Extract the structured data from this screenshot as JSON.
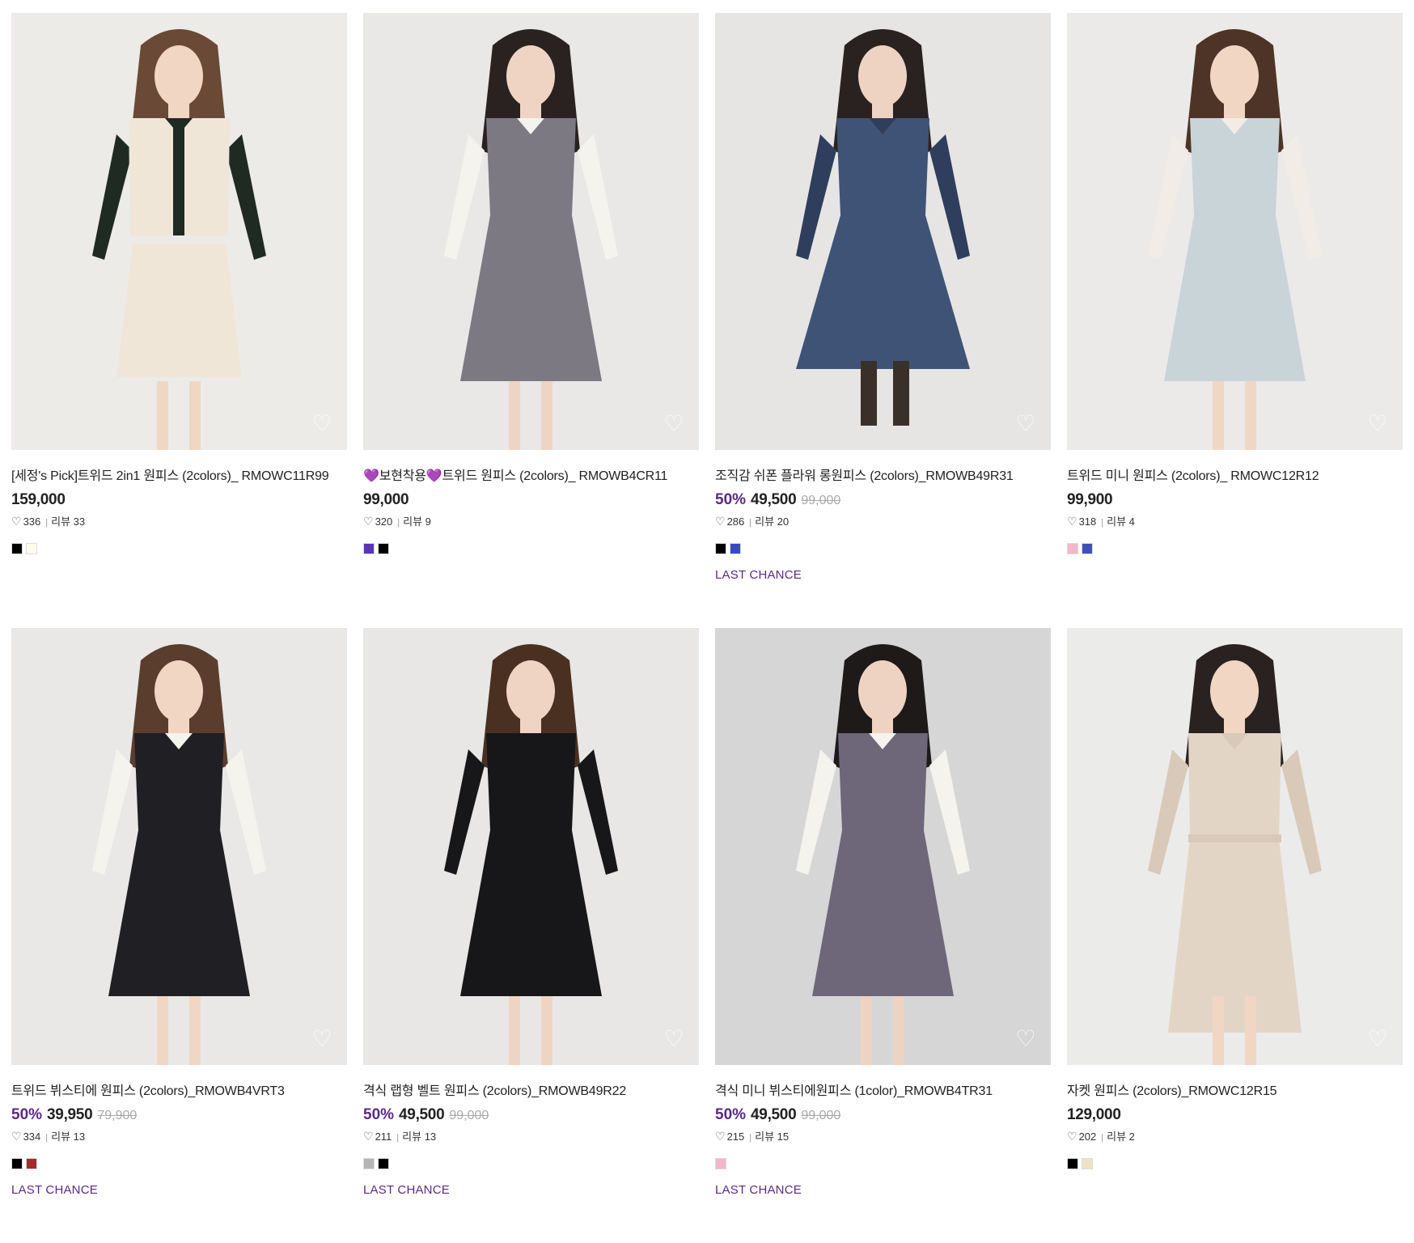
{
  "products": [
    {
      "name": "[세정's Pick]트위드 2in1 원피스 (2colors)_ RMOWC11R99",
      "discount": "",
      "price": "159,000",
      "original_price": "",
      "likes": "336",
      "reviews_label": "리뷰 33",
      "swatches": [
        "#000000",
        "#fffbea"
      ],
      "tag": "",
      "image": {
        "bg": "#ecebe8",
        "garment": "#efe6d8",
        "accent": "#1f2b22",
        "hair": "#6a4a36",
        "skin": "#f1d6c4",
        "type": "tweed-set"
      }
    },
    {
      "name": "💜보현착용💜트위드 원피스 (2colors)_ RMOWB4CR11",
      "discount": "",
      "price": "99,000",
      "original_price": "",
      "likes": "320",
      "reviews_label": "리뷰 9",
      "swatches": [
        "#5a35b5",
        "#000000"
      ],
      "tag": "",
      "image": {
        "bg": "#e9e8e6",
        "garment": "#7c7983",
        "accent": "#f5f3ee",
        "hair": "#2a2220",
        "skin": "#f0d4c3",
        "type": "vest-dress"
      }
    },
    {
      "name": "조직감 쉬폰 플라워 롱원피스 (2colors)_RMOWB49R31",
      "discount": "50%",
      "price": "49,500",
      "original_price": "99,000",
      "likes": "286",
      "reviews_label": "리뷰 20",
      "swatches": [
        "#000000",
        "#3549c4"
      ],
      "tag": "LAST CHANCE",
      "image": {
        "bg": "#e6e5e3",
        "garment": "#3f5377",
        "accent": "#2f3e5c",
        "hair": "#2a2220",
        "skin": "#efd3c2",
        "type": "long-dress"
      }
    },
    {
      "name": "트위드 미니 원피스 (2colors)_ RMOWC12R12",
      "discount": "",
      "price": "99,900",
      "original_price": "",
      "likes": "318",
      "reviews_label": "리뷰 4",
      "swatches": [
        "#f4b6c8",
        "#3f4fbf"
      ],
      "tag": "",
      "image": {
        "bg": "#ebeae8",
        "garment": "#c9d4d9",
        "accent": "#f1ede6",
        "hair": "#4e3426",
        "skin": "#f1d6c4",
        "type": "mini-dress"
      }
    },
    {
      "name": "트위드 뷔스티에 원피스 (2colors)_RMOWB4VRT3",
      "discount": "50%",
      "price": "39,950",
      "original_price": "79,900",
      "likes": "334",
      "reviews_label": "리뷰 13",
      "swatches": [
        "#000000",
        "#a52a2a"
      ],
      "tag": "LAST CHANCE",
      "image": {
        "bg": "#e9e8e6",
        "garment": "#1f1f24",
        "accent": "#f5f3ee",
        "hair": "#5a3d2c",
        "skin": "#f1d6c4",
        "type": "flare-dress"
      }
    },
    {
      "name": "격식 랩형 벨트 원피스 (2colors)_RMOWB49R22",
      "discount": "50%",
      "price": "49,500",
      "original_price": "99,000",
      "likes": "211",
      "reviews_label": "리뷰 13",
      "swatches": [
        "#b5b5b5",
        "#000000"
      ],
      "tag": "LAST CHANCE",
      "image": {
        "bg": "#e8e7e5",
        "garment": "#17171a",
        "accent": "#17171a",
        "hair": "#4a3020",
        "skin": "#f0d4c3",
        "type": "black-dress"
      }
    },
    {
      "name": "격식 미니 뷔스티에원피스 (1color)_RMOWB4TR31",
      "discount": "50%",
      "price": "49,500",
      "original_price": "99,000",
      "likes": "215",
      "reviews_label": "리뷰 15",
      "swatches": [
        "#f5b5cc"
      ],
      "tag": "LAST CHANCE",
      "image": {
        "bg": "#d6d6d7",
        "garment": "#6e6679",
        "accent": "#f5f3ee",
        "hair": "#1e1a1a",
        "skin": "#efd3c2",
        "type": "vest-dress"
      }
    },
    {
      "name": "자켓 원피스 (2colors)_RMOWC12R15",
      "discount": "",
      "price": "129,000",
      "original_price": "",
      "likes": "202",
      "reviews_label": "리뷰 2",
      "swatches": [
        "#000000",
        "#ece4c4"
      ],
      "tag": "",
      "image": {
        "bg": "#ebebea",
        "garment": "#e3d5c6",
        "accent": "#d9c9b8",
        "hair": "#2a2220",
        "skin": "#f1d6c4",
        "type": "jacket-dress"
      }
    }
  ],
  "icons": {
    "like": "heart-outline-icon",
    "wishlist": "heart-outline-icon"
  },
  "colors": {
    "accent": "#5b2a86",
    "strikethrough": "#aaaaaa"
  }
}
